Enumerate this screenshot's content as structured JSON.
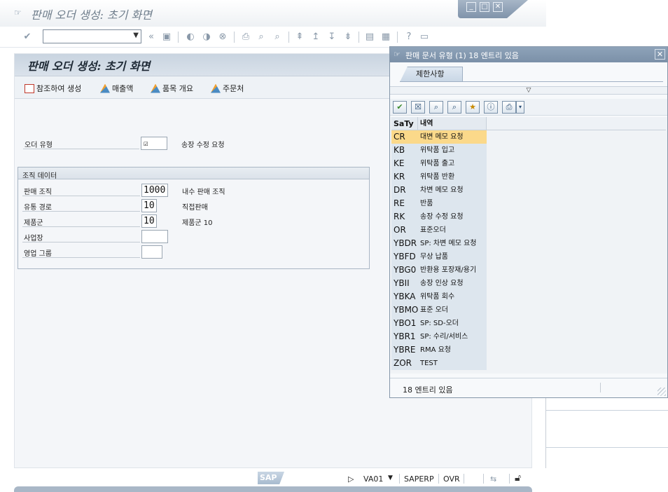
{
  "window": {
    "title": "판매 오더 생성: 초기 화면"
  },
  "toolbar": {
    "command_value": "",
    "back_glyph": "«"
  },
  "panel": {
    "title": "판매 오더 생성: 초기 화면",
    "buttons": [
      {
        "label": "참조하여 생성"
      },
      {
        "label": "매출액"
      },
      {
        "label": "품목 개요"
      },
      {
        "label": "주문처"
      }
    ]
  },
  "order_type": {
    "label": "오더 유형",
    "value": "",
    "description": "송장 수정 요청"
  },
  "org": {
    "title": "조직 데이터",
    "fields": [
      {
        "label": "판매 조직",
        "value": "1000",
        "description": "내수 판매 조직"
      },
      {
        "label": "유통 경로",
        "value": "10",
        "description": "직접판매"
      },
      {
        "label": "제품군",
        "value": "10",
        "description": "제품군 10"
      },
      {
        "label": "사업장",
        "value": "",
        "description": ""
      },
      {
        "label": "영업 그룹",
        "value": "",
        "description": ""
      }
    ]
  },
  "status": {
    "logo": "SAP",
    "transaction": "VA01",
    "system": "SAPERP",
    "mode": "OVR"
  },
  "popup": {
    "title": "판매 문서 유형 (1)   18 엔트리 있음",
    "tab_label": "제한사항",
    "collapse_glyph": "▽",
    "columns": {
      "code": "SaTy",
      "desc": "내역"
    },
    "rows": [
      {
        "code": "CR",
        "desc": "대변 메모 요청"
      },
      {
        "code": "KB",
        "desc": "위탁품 입고"
      },
      {
        "code": "KE",
        "desc": "위탁품 출고"
      },
      {
        "code": "KR",
        "desc": "위탁품 반환"
      },
      {
        "code": "DR",
        "desc": "차변 메모 요청"
      },
      {
        "code": "RE",
        "desc": "반품"
      },
      {
        "code": "RK",
        "desc": "송장 수정 요청"
      },
      {
        "code": "OR",
        "desc": "표준오더"
      },
      {
        "code": "YBDR",
        "desc": "SP: 차변 메모 요청"
      },
      {
        "code": "YBFD",
        "desc": "무상 납품"
      },
      {
        "code": "YBG0",
        "desc": "반환용 포장재/용기"
      },
      {
        "code": "YBII",
        "desc": "송장 인상 요청"
      },
      {
        "code": "YBKA",
        "desc": "위탁품 회수"
      },
      {
        "code": "YBMO",
        "desc": "표준 오더"
      },
      {
        "code": "YBO1",
        "desc": "SP: SD-오더"
      },
      {
        "code": "YBR1",
        "desc": "SP: 수리/서비스"
      },
      {
        "code": "YBRE",
        "desc": "RMA 요청"
      },
      {
        "code": "ZOR",
        "desc": "TEST"
      }
    ],
    "selected_index": 0,
    "status_text": "18 엔트리 있음"
  },
  "colors": {
    "accent": "#7b90a8",
    "selection": "#fbd98a",
    "panel_header": "#c9d4e0"
  }
}
